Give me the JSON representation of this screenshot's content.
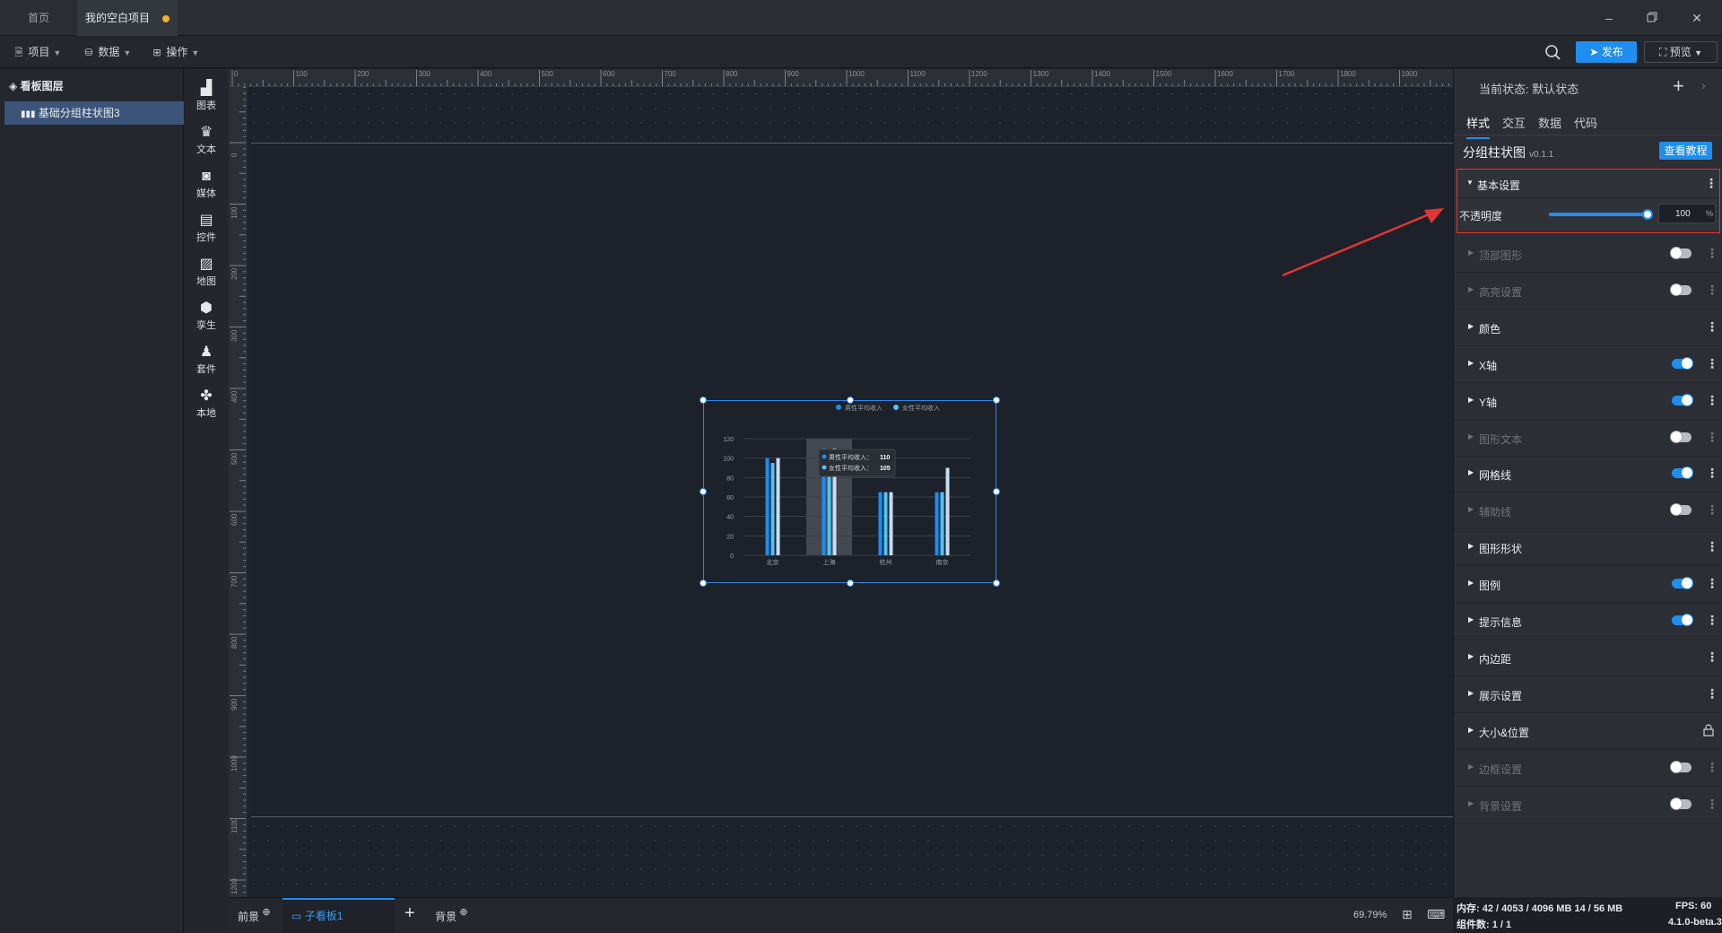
{
  "titlebar": {
    "tabs": [
      "首页",
      "我的空白项目"
    ]
  },
  "toolbar": {
    "menus": [
      "项目",
      "数据",
      "操作"
    ],
    "publish_label": "发布",
    "preview_label": "预览"
  },
  "layers": {
    "title": "看板图层",
    "items": [
      "基础分组柱状图3"
    ]
  },
  "components": [
    "图表",
    "文本",
    "媒体",
    "控件",
    "地图",
    "孪生",
    "套件",
    "本地"
  ],
  "ruler": {
    "top_labels": [
      "0",
      "100",
      "200",
      "300",
      "400",
      "500",
      "600",
      "700",
      "800",
      "900",
      "1000",
      "1100",
      "1200",
      "1300",
      "1400",
      "1500",
      "1600",
      "1700",
      "1800",
      "1900"
    ],
    "left_labels": [
      "0",
      "100",
      "200",
      "300",
      "400",
      "500",
      "600",
      "700",
      "800",
      "900",
      "1000",
      "1100",
      "1200"
    ]
  },
  "chart_data": {
    "type": "bar",
    "categories": [
      "北京",
      "上海",
      "杭州",
      "南京"
    ],
    "series": [
      {
        "name": "男性平均收入",
        "values": [
          100,
          110,
          65,
          65
        ],
        "color": "#1a8ef5"
      },
      {
        "name": "女性平均收入",
        "values": [
          95,
          105,
          65,
          65
        ],
        "color": "#4fc3f7"
      },
      {
        "name": "",
        "values": [
          100,
          110,
          65,
          90
        ],
        "color": "#c8dcf2"
      }
    ],
    "yticks": [
      "0",
      "20",
      "40",
      "60",
      "80",
      "100",
      "120"
    ],
    "ylim": [
      0,
      120
    ],
    "highlight_category": "上海",
    "tooltip": {
      "rows": [
        {
          "label": "男性平均收入：",
          "value": "110",
          "color": "#1a8ef5"
        },
        {
          "label": "女性平均收入：",
          "value": "105",
          "color": "#4fc3f7"
        }
      ]
    },
    "legend_position": "top-right"
  },
  "bottombar": {
    "front_label": "前景",
    "board_label": "子看板1",
    "back_label": "背景",
    "zoom": "69.79%"
  },
  "status": {
    "memory": "内存: 42 / 4053 / 4096 MB 14 / 56 MB",
    "fps": "FPS: 60",
    "count": "组件数: 1 / 1",
    "version": "4.1.0-beta.3"
  },
  "panel": {
    "state_label": "当前状态:  默认状态",
    "tabs": [
      "样式",
      "交互",
      "数据",
      "代码"
    ],
    "active_tab": 0,
    "component_name": "分组柱状图",
    "component_version": "v0.1.1",
    "tutorial_label": "查看教程",
    "basic_title": "基本设置",
    "opacity_label": "不透明度",
    "opacity_value": "100",
    "opacity_unit": "%",
    "opacity_level": 1.0,
    "sections": [
      {
        "label": "顶部图形",
        "enabled": false,
        "control": "toggle-off"
      },
      {
        "label": "高亮设置",
        "enabled": false,
        "control": "toggle-off"
      },
      {
        "label": "颜色",
        "enabled": true,
        "control": "none"
      },
      {
        "label": "X轴",
        "enabled": true,
        "control": "toggle-on"
      },
      {
        "label": "Y轴",
        "enabled": true,
        "control": "toggle-on"
      },
      {
        "label": "图形文本",
        "enabled": false,
        "control": "toggle-off"
      },
      {
        "label": "网格线",
        "enabled": true,
        "control": "toggle-on"
      },
      {
        "label": "辅助线",
        "enabled": false,
        "control": "toggle-off"
      },
      {
        "label": "图形形状",
        "enabled": true,
        "control": "none"
      },
      {
        "label": "图例",
        "enabled": true,
        "control": "toggle-on"
      },
      {
        "label": "提示信息",
        "enabled": true,
        "control": "toggle-on"
      },
      {
        "label": "内边距",
        "enabled": true,
        "control": "none"
      },
      {
        "label": "展示设置",
        "enabled": true,
        "control": "none"
      },
      {
        "label": "大小&位置",
        "enabled": true,
        "control": "lock"
      },
      {
        "label": "边框设置",
        "enabled": false,
        "control": "toggle-off"
      },
      {
        "label": "背景设置",
        "enabled": false,
        "control": "toggle-off"
      }
    ]
  },
  "colors": {
    "accent": "#1e8ef0",
    "highlight_border": "#e03535",
    "annotation_arrow": "#e03535"
  }
}
